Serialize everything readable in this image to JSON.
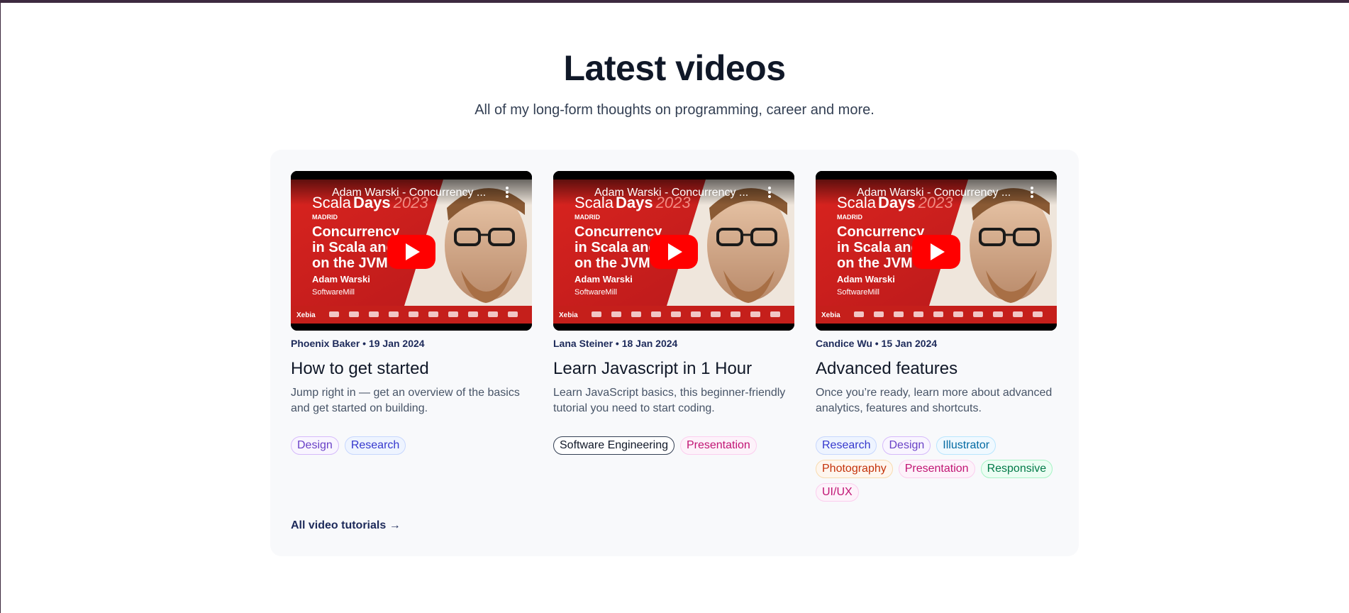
{
  "header": {
    "title": "Latest videos",
    "subtitle": "All of my long-form thoughts on programming, career and more."
  },
  "video_thumbnail": {
    "video_title": "Adam Warski - Concurrency ...",
    "brand_scala": "Scala",
    "brand_days": "Days",
    "brand_year": "2023",
    "city": "MADRID",
    "headline_lines": [
      "Concurrency",
      "in Scala and",
      "on the JVM"
    ],
    "speaker": "Adam Warski",
    "company": "SoftwareMill",
    "sponsor_logo": "Xebia",
    "icons": [
      "more-options-icon",
      "play-icon"
    ]
  },
  "cards": [
    {
      "author_date": "Phoenix Baker • 19 Jan 2024",
      "title": "How to get started",
      "description": "Jump right in — get an overview of the basics and get started on building.",
      "tags": [
        {
          "label": "Design",
          "color": "#6941c6",
          "border": "#d6bbfb",
          "bg": "#f9f5ff"
        },
        {
          "label": "Research",
          "color": "#3538cd",
          "border": "#c7d7fe",
          "bg": "#eef4ff"
        }
      ]
    },
    {
      "author_date": "Lana Steiner • 18 Jan 2024",
      "title": "Learn Javascript in 1 Hour",
      "description": "Learn JavaScript basics, this beginner-friendly tutorial you need to start coding.",
      "tags": [
        {
          "label": "Software Engineering",
          "color": "#101828",
          "border": "#344054",
          "bg": "#ffffff"
        },
        {
          "label": "Presentation",
          "color": "#c11574",
          "border": "#fcceee",
          "bg": "#fdf2fa"
        }
      ]
    },
    {
      "author_date": "Candice Wu • 15 Jan 2024",
      "title": "Advanced features",
      "description": "Once you’re ready, learn more about advanced analytics, features and shortcuts.",
      "tags": [
        {
          "label": "Research",
          "color": "#3538cd",
          "border": "#c7d7fe",
          "bg": "#eef4ff"
        },
        {
          "label": "Design",
          "color": "#6941c6",
          "border": "#d6bbfb",
          "bg": "#f9f5ff"
        },
        {
          "label": "Illustrator",
          "color": "#026aa2",
          "border": "#b9e6fe",
          "bg": "#f0f9ff"
        },
        {
          "label": "Photography",
          "color": "#c4320a",
          "border": "#f9dbaf",
          "bg": "#fef6ee"
        },
        {
          "label": "Presentation",
          "color": "#c11574",
          "border": "#fcceee",
          "bg": "#fdf2fa"
        },
        {
          "label": "Responsive",
          "color": "#027a48",
          "border": "#a6f4c5",
          "bg": "#ecfdf3"
        },
        {
          "label": "UI/UX",
          "color": "#c11574",
          "border": "#fcceee",
          "bg": "#fdf2fa"
        }
      ]
    }
  ],
  "footer_link": "All video tutorials →"
}
